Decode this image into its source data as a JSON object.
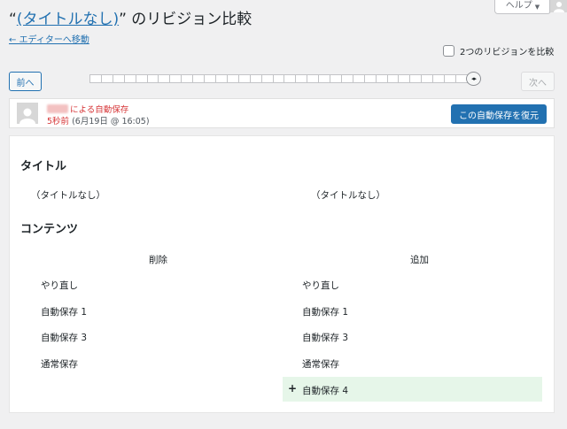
{
  "header": {
    "title_prefix": "“",
    "title_link": "(タイトルなし)",
    "title_suffix": "” のリビジョン比較",
    "back_link": "← エディターへ移動",
    "help_label": "ヘルプ",
    "help_caret": "▼"
  },
  "compare": {
    "label": "2つのリビジョンを比較",
    "checked": false
  },
  "nav": {
    "prev_label": "前へ",
    "next_label": "次へ",
    "slider_ticks": 34,
    "slider_value_fraction": 1.0,
    "handle_glyph": "◂▸"
  },
  "author": {
    "action": "による自動保存",
    "time_ago": "5秒前",
    "date": "(6月19日 @ 16:05)",
    "restore_label": "この自動保存を復元"
  },
  "diff": {
    "title_section": "タイトル",
    "title_old": "（タイトルなし）",
    "title_new": "（タイトルなし）",
    "content_section": "コンテンツ",
    "col_removed": "削除",
    "col_added": "追加",
    "left_rows": [
      "やり直し",
      "自動保存 1",
      "自動保存 3",
      "通常保存"
    ],
    "right_rows": [
      "やり直し",
      "自動保存 1",
      "自動保存 3",
      "通常保存"
    ],
    "added_row": "自動保存 4",
    "added_marker": "+"
  },
  "colors": {
    "accent": "#2271b1",
    "autosave_red": "#d63638",
    "added_bg": "#e6f6e9",
    "background": "#f0f0f1"
  }
}
